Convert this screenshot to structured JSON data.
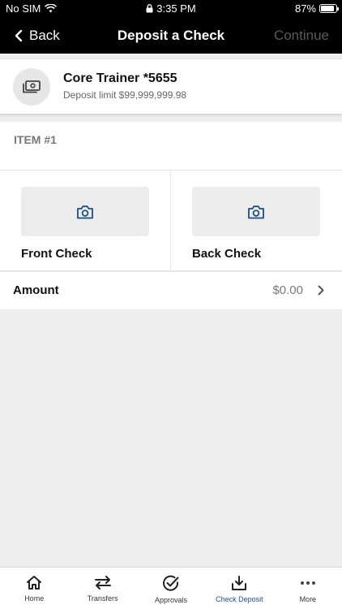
{
  "status_bar": {
    "carrier": "No SIM",
    "time": "3:35 PM",
    "battery": "87%",
    "battery_level": 0.87
  },
  "nav": {
    "back_label": "Back",
    "title": "Deposit a Check",
    "continue_label": "Continue"
  },
  "account": {
    "name": "Core Trainer *5655",
    "deposit_limit": "Deposit limit $99,999,999.98",
    "icon": "cash-icon"
  },
  "item": {
    "title": "ITEM #1"
  },
  "checks": {
    "front_label": "Front Check",
    "back_label": "Back Check",
    "icon": "camera-icon"
  },
  "amount": {
    "label": "Amount",
    "value": "$0.00"
  },
  "tabs": [
    {
      "label": "Home",
      "icon": "home-icon",
      "active": false
    },
    {
      "label": "Transfers",
      "icon": "transfer-arrows-icon",
      "active": false
    },
    {
      "label": "Approvals",
      "icon": "check-circle-icon",
      "active": false
    },
    {
      "label": "Check Deposit",
      "icon": "download-tray-icon",
      "active": true
    },
    {
      "label": "More",
      "icon": "more-dots-icon",
      "active": false
    }
  ],
  "colors": {
    "accent": "#1c4f82",
    "header_bg": "#000000",
    "page_bg": "#efeeee"
  }
}
